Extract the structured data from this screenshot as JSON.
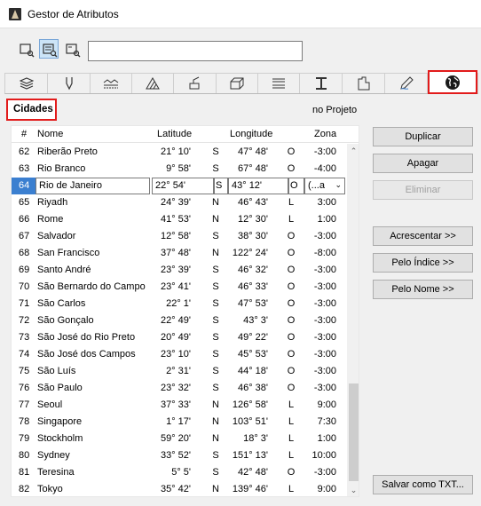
{
  "window": {
    "title": "Gestor de Atributos"
  },
  "toolbar": {
    "buttons": [
      {
        "icon": "list-view-icon",
        "active": false
      },
      {
        "icon": "grid-view-icon",
        "active": true
      },
      {
        "icon": "detail-view-icon",
        "active": false
      }
    ],
    "search_value": ""
  },
  "tabs": [
    {
      "icon": "layers-icon"
    },
    {
      "icon": "pen-icon"
    },
    {
      "icon": "line-types-icon"
    },
    {
      "icon": "fill-icon"
    },
    {
      "icon": "surface-paint-icon"
    },
    {
      "icon": "building-materials-icon"
    },
    {
      "icon": "composites-icon"
    },
    {
      "icon": "profile-icon"
    },
    {
      "icon": "zone-category-icon"
    },
    {
      "icon": "markup-icon"
    },
    {
      "icon": "globe-icon",
      "selected": true
    }
  ],
  "section": {
    "label": "Cidades",
    "scope": "no Projeto"
  },
  "table": {
    "headers": {
      "num": "#",
      "name": "Nome",
      "lat": "Latitude",
      "lon": "Longitude",
      "zone": "Zona"
    },
    "rows": [
      {
        "num": "62",
        "name": "Riberão Preto",
        "lat": "21° 10'",
        "ns": "S",
        "lon": "47° 48'",
        "ew": "O",
        "zone": "-3:00"
      },
      {
        "num": "63",
        "name": "Rio Branco",
        "lat": "9° 58'",
        "ns": "S",
        "lon": "67° 48'",
        "ew": "O",
        "zone": "-4:00"
      },
      {
        "num": "64",
        "name": "Rio de Janeiro",
        "lat": "22° 54'",
        "ns": "S",
        "lon": "43° 12'",
        "ew": "O",
        "zone": "(...a",
        "editing": true
      },
      {
        "num": "65",
        "name": "Riyadh",
        "lat": "24° 39'",
        "ns": "N",
        "lon": "46° 43'",
        "ew": "L",
        "zone": "3:00"
      },
      {
        "num": "66",
        "name": "Rome",
        "lat": "41° 53'",
        "ns": "N",
        "lon": "12° 30'",
        "ew": "L",
        "zone": "1:00"
      },
      {
        "num": "67",
        "name": "Salvador",
        "lat": "12° 58'",
        "ns": "S",
        "lon": "38° 30'",
        "ew": "O",
        "zone": "-3:00"
      },
      {
        "num": "68",
        "name": "San Francisco",
        "lat": "37° 48'",
        "ns": "N",
        "lon": "122° 24'",
        "ew": "O",
        "zone": "-8:00"
      },
      {
        "num": "69",
        "name": "Santo André",
        "lat": "23° 39'",
        "ns": "S",
        "lon": "46° 32'",
        "ew": "O",
        "zone": "-3:00"
      },
      {
        "num": "70",
        "name": "São Bernardo do Campo",
        "lat": "23° 41'",
        "ns": "S",
        "lon": "46° 33'",
        "ew": "O",
        "zone": "-3:00"
      },
      {
        "num": "71",
        "name": "São Carlos",
        "lat": "22° 1'",
        "ns": "S",
        "lon": "47° 53'",
        "ew": "O",
        "zone": "-3:00"
      },
      {
        "num": "72",
        "name": "São Gonçalo",
        "lat": "22° 49'",
        "ns": "S",
        "lon": "43° 3'",
        "ew": "O",
        "zone": "-3:00"
      },
      {
        "num": "73",
        "name": "São José do Rio Preto",
        "lat": "20° 49'",
        "ns": "S",
        "lon": "49° 22'",
        "ew": "O",
        "zone": "-3:00"
      },
      {
        "num": "74",
        "name": "São José dos Campos",
        "lat": "23° 10'",
        "ns": "S",
        "lon": "45° 53'",
        "ew": "O",
        "zone": "-3:00"
      },
      {
        "num": "75",
        "name": "São Luís",
        "lat": "2° 31'",
        "ns": "S",
        "lon": "44° 18'",
        "ew": "O",
        "zone": "-3:00"
      },
      {
        "num": "76",
        "name": "São Paulo",
        "lat": "23° 32'",
        "ns": "S",
        "lon": "46° 38'",
        "ew": "O",
        "zone": "-3:00"
      },
      {
        "num": "77",
        "name": "Seoul",
        "lat": "37° 33'",
        "ns": "N",
        "lon": "126° 58'",
        "ew": "L",
        "zone": "9:00"
      },
      {
        "num": "78",
        "name": "Singapore",
        "lat": "1° 17'",
        "ns": "N",
        "lon": "103° 51'",
        "ew": "L",
        "zone": "7:30"
      },
      {
        "num": "79",
        "name": "Stockholm",
        "lat": "59° 20'",
        "ns": "N",
        "lon": "18° 3'",
        "ew": "L",
        "zone": "1:00"
      },
      {
        "num": "80",
        "name": "Sydney",
        "lat": "33° 52'",
        "ns": "S",
        "lon": "151° 13'",
        "ew": "L",
        "zone": "10:00"
      },
      {
        "num": "81",
        "name": "Teresina",
        "lat": "5° 5'",
        "ns": "S",
        "lon": "42° 48'",
        "ew": "O",
        "zone": "-3:00"
      },
      {
        "num": "82",
        "name": "Tokyo",
        "lat": "35° 42'",
        "ns": "N",
        "lon": "139° 46'",
        "ew": "L",
        "zone": "9:00"
      }
    ]
  },
  "buttons": {
    "duplicate": "Duplicar",
    "delete": "Apagar",
    "remove": "Eliminar",
    "append": "Acrescentar >>",
    "by_index": "Pelo Índice >>",
    "by_name": "Pelo Nome >>",
    "save_txt": "Salvar como TXT..."
  },
  "colors": {
    "highlight": "#e21b1b",
    "selection": "#3b7fd0"
  }
}
